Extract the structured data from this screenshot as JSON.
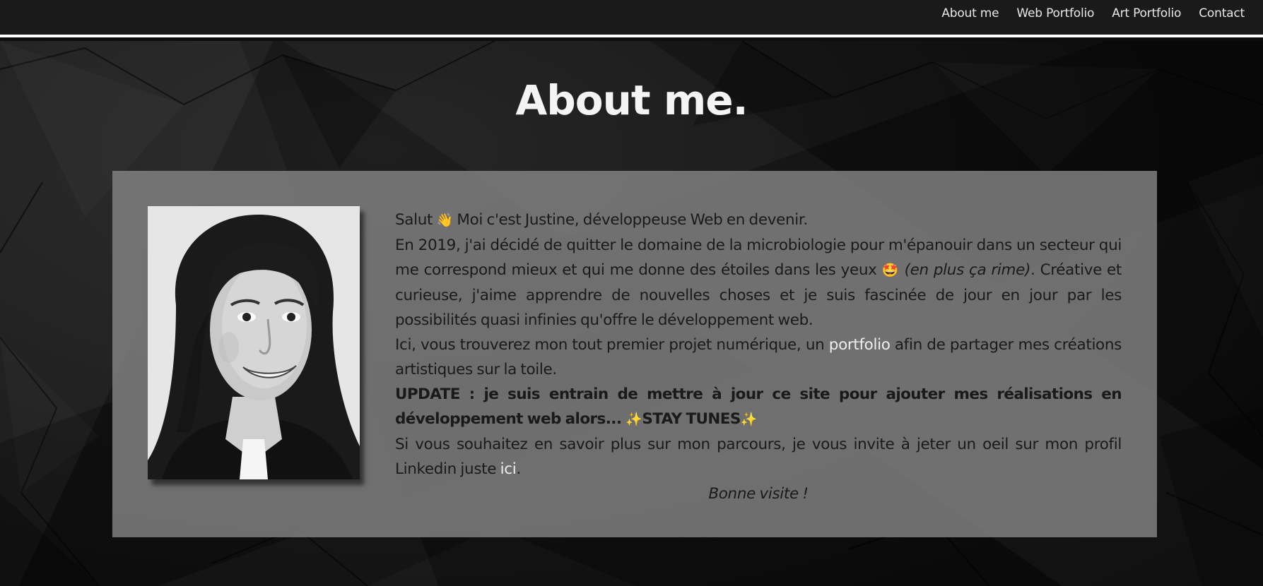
{
  "nav": {
    "items": [
      "About me",
      "Web Portfolio",
      "Art Portfolio",
      "Contact"
    ]
  },
  "page": {
    "title": "About me."
  },
  "about": {
    "greeting_pre": "Salut ",
    "greeting_emoji": "👋",
    "greeting_post": " Moi c'est Justine, développeuse Web en devenir.",
    "p2_text": "En 2019, j'ai décidé de quitter le domaine de la microbiologie pour m'épanouir dans un secteur qui me correspond mieux et qui me donne des étoiles dans les yeux ",
    "p2_emoji": "🤩",
    "p2_italic": " (en plus ça rime)",
    "p2_rest": ". Créative et curieuse, j'aime apprendre de nouvelles choses et je suis fascinée de jour en jour par les possibilités quasi infinies qu'offre le développement web.",
    "p3_pre": "Ici, vous trouverez mon tout premier projet numérique, un ",
    "p3_link": "portfolio",
    "p3_post": " afin de partager mes créations artistiques sur la toile.",
    "update_text": "UPDATE : je suis entrain de mettre à jour ce site pour ajouter mes réalisations en développement web alors... ",
    "update_sparkle": "✨",
    "update_stay": "STAY TUNES",
    "p5_pre": "Si vous souhaitez en savoir plus sur mon parcours, je vous invite à jeter un oeil sur mon profil Linkedin juste ",
    "p5_link": "ici",
    "p5_post": ".",
    "signoff": "Bonne visite !"
  },
  "colors": {
    "navbar_bg": "#1a1a1a",
    "card_bg": "#808080",
    "link": "#eeeeee",
    "text": "#1a1a1a"
  }
}
